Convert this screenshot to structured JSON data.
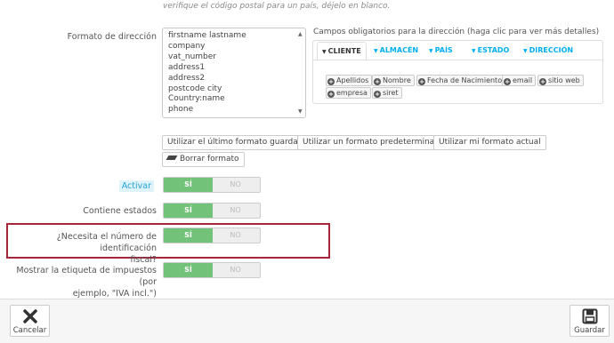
{
  "hint": "verifique el código postal para un país, déjelo en blanco.",
  "address_format": {
    "label": "Formato de dirección",
    "lines": [
      "firstname lastname",
      "company",
      "vat_number",
      "address1",
      "address2",
      "postcode city",
      "Country:name",
      "phone"
    ]
  },
  "required_fields": {
    "title": "Campos obligatorios para la dirección (haga clic para ver más detalles)",
    "tabs": [
      "CLIENTE",
      "ALMACÉN",
      "PAÍS",
      "ESTADO",
      "DIRECCIÓN"
    ],
    "active_tab": "CLIENTE",
    "chips": [
      "Apellidos",
      "Nombre",
      "Fecha de Nacimiento",
      "email",
      "sitio web",
      "empresa",
      "siret"
    ]
  },
  "format_buttons": {
    "last_saved": "Utilizar el último formato guardado",
    "default": "Utilizar un formato predeterminado",
    "current": "Utilizar mi formato actual",
    "clear": "Borrar formato"
  },
  "settings": [
    {
      "label": "Activar",
      "yes": "SÍ",
      "no": "NO",
      "value": "SÍ"
    },
    {
      "label": "Contiene estados",
      "yes": "SÍ",
      "no": "NO",
      "value": "SÍ"
    },
    {
      "label": "¿Necesita el número de identificación fiscal?",
      "label_line1": "¿Necesita el número de identificación",
      "label_line2": "fiscal?",
      "yes": "SÍ",
      "no": "NO",
      "value": "SÍ"
    },
    {
      "label": "Mostrar la etiqueta de impuestos (por ejemplo, \"IVA incl.\")",
      "label_line1": "Mostrar la etiqueta de impuestos (por",
      "label_line2": "ejemplo, \"IVA incl.\")",
      "yes": "SÍ",
      "no": "NO",
      "value": "SÍ"
    }
  ],
  "footer": {
    "cancel": "Cancelar",
    "save": "Guardar"
  },
  "colors": {
    "toggle_on": "#72c279",
    "tab_link": "#00aff0",
    "highlight_border": "#a8263a"
  }
}
